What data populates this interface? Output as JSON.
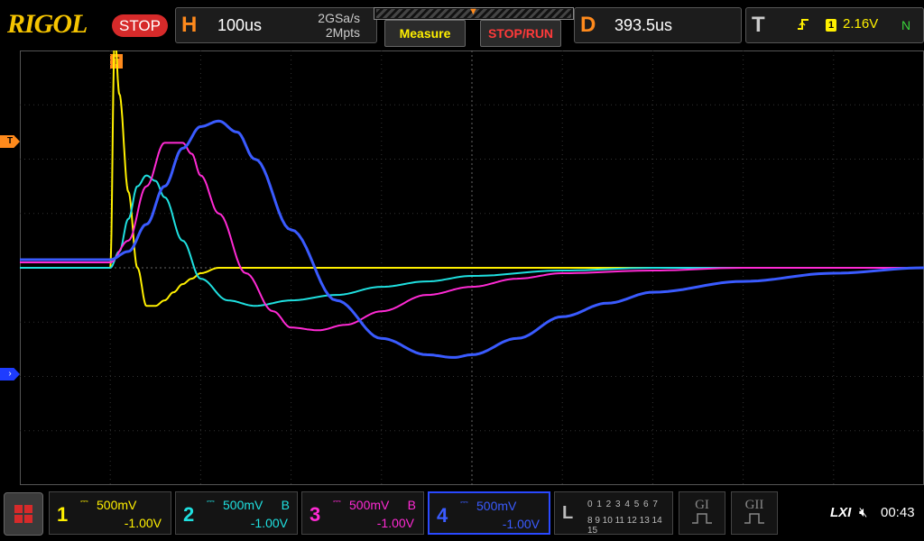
{
  "brand": "RIGOL",
  "run_state": "STOP",
  "horizontal": {
    "letter": "H",
    "timebase": "100us",
    "sample_rate": "2GSa/s",
    "memory_depth": "2Mpts"
  },
  "buttons": {
    "measure": "Measure",
    "stop_run": "STOP/RUN"
  },
  "delay": {
    "letter": "D",
    "value": "393.5us"
  },
  "trigger": {
    "letter": "T",
    "edge_icon": "rising-edge-icon",
    "source": "1",
    "level": "2.16V",
    "mode": "N",
    "marker": "T"
  },
  "channels": [
    {
      "num": "1",
      "scale": "500mV",
      "bw": "",
      "offset": "-1.00V",
      "color": "#fff000"
    },
    {
      "num": "2",
      "scale": "500mV",
      "bw": "B",
      "offset": "-1.00V",
      "color": "#1fe0e0"
    },
    {
      "num": "3",
      "scale": "500mV",
      "bw": "B",
      "offset": "-1.00V",
      "color": "#ff2ad4"
    },
    {
      "num": "4",
      "scale": "500mV",
      "bw": "",
      "offset": "-1.00V",
      "color": "#3a5bff"
    }
  ],
  "logic": {
    "letter": "L",
    "row1": "0 1 2 3  4 5 6 7",
    "row2": "8 9 10 11 12 13 14 15"
  },
  "generators": {
    "g1": "GI",
    "g2": "GII"
  },
  "status": {
    "lxi": "LXI",
    "time": "00:43"
  },
  "colors": {
    "trigger": "#ff8a1c",
    "grid": "#333333",
    "accent": "#d62a2a"
  },
  "chart_data": {
    "type": "line",
    "x_unit": "us",
    "x_range": [
      -100,
      900
    ],
    "y_unit": "div",
    "y_range": [
      -4,
      4
    ],
    "series": [
      {
        "name": "1",
        "color": "#fff000",
        "x": [
          -100,
          0,
          5,
          10,
          20,
          30,
          40,
          50,
          60,
          70,
          80,
          90,
          100,
          120,
          150,
          200,
          300,
          400,
          500,
          600,
          700,
          800,
          900
        ],
        "y": [
          0,
          0,
          4.3,
          3.2,
          1.4,
          0,
          -0.7,
          -0.7,
          -0.6,
          -0.45,
          -0.3,
          -0.2,
          -0.1,
          0,
          0,
          0,
          0,
          0,
          0,
          0,
          0,
          0,
          0
        ]
      },
      {
        "name": "2",
        "color": "#1fe0e0",
        "x": [
          -100,
          0,
          10,
          20,
          30,
          40,
          50,
          60,
          80,
          100,
          130,
          160,
          200,
          250,
          300,
          350,
          400,
          500,
          600,
          700,
          800,
          900
        ],
        "y": [
          0,
          0,
          0.3,
          0.9,
          1.5,
          1.7,
          1.6,
          1.3,
          0.5,
          -0.2,
          -0.6,
          -0.7,
          -0.6,
          -0.5,
          -0.35,
          -0.25,
          -0.15,
          -0.05,
          0,
          0,
          0,
          0
        ]
      },
      {
        "name": "3",
        "color": "#ff2ad4",
        "x": [
          -100,
          0,
          20,
          40,
          60,
          80,
          90,
          100,
          120,
          150,
          180,
          200,
          230,
          260,
          300,
          350,
          400,
          450,
          500,
          600,
          700,
          800,
          900
        ],
        "y": [
          0.1,
          0.1,
          0.5,
          1.5,
          2.3,
          2.3,
          2.1,
          1.7,
          1.0,
          -0.1,
          -0.8,
          -1.1,
          -1.15,
          -1.05,
          -0.8,
          -0.5,
          -0.35,
          -0.2,
          -0.1,
          -0.05,
          0,
          0,
          0
        ]
      },
      {
        "name": "4",
        "color": "#3a5bff",
        "x": [
          -100,
          0,
          20,
          40,
          60,
          80,
          100,
          120,
          140,
          160,
          200,
          250,
          300,
          350,
          380,
          400,
          450,
          500,
          550,
          600,
          700,
          800,
          900
        ],
        "y": [
          0.15,
          0.15,
          0.3,
          0.8,
          1.5,
          2.2,
          2.6,
          2.7,
          2.5,
          2.0,
          0.7,
          -0.6,
          -1.3,
          -1.6,
          -1.65,
          -1.6,
          -1.3,
          -0.9,
          -0.65,
          -0.45,
          -0.25,
          -0.1,
          0
        ]
      }
    ]
  }
}
